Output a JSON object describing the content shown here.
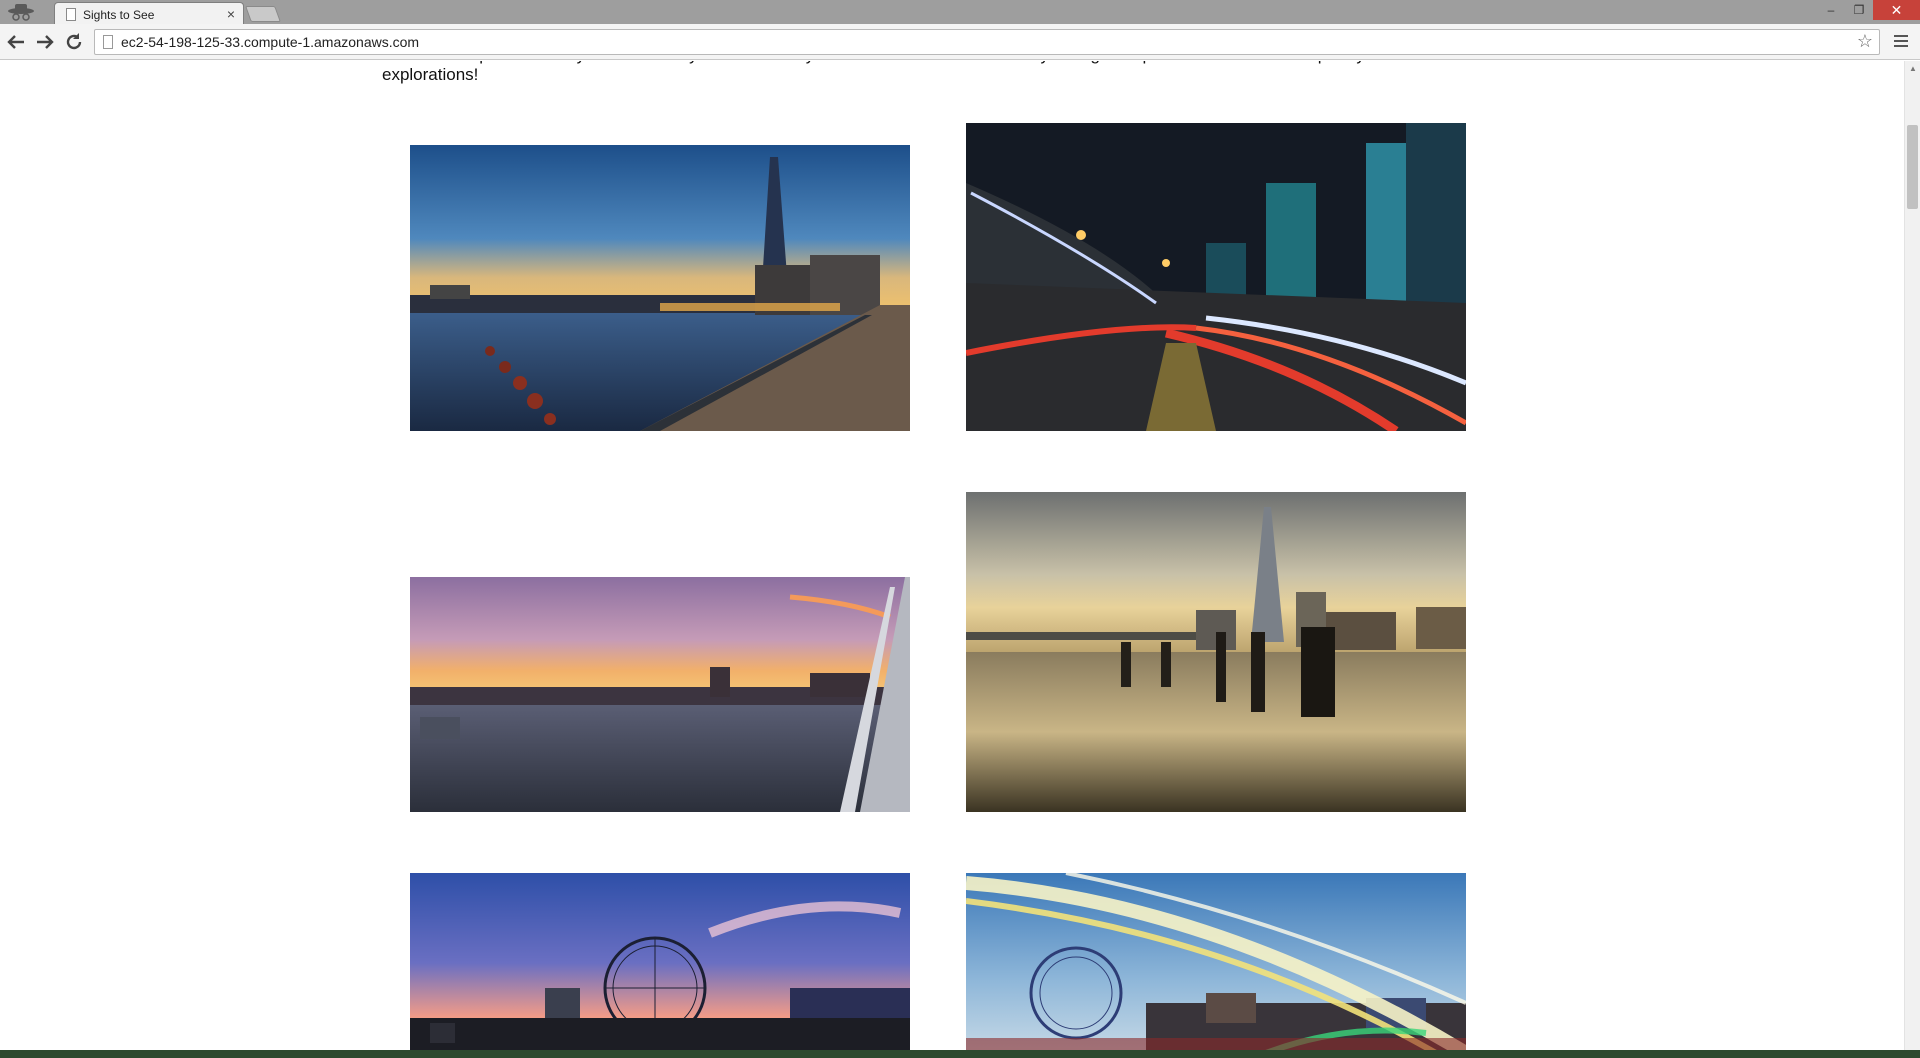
{
  "browser": {
    "tab_title": "Sights to See",
    "tab_close": "×",
    "address": "ec2-54-198-125-33.compute-1.amazonaws.com",
    "window_controls": {
      "minimize": "–",
      "maximize": "❐",
      "close": "✕"
    }
  },
  "page": {
    "intro_text": "Just click on pictures that you like. Once you've finished you can then click on the \"Always bring a Map!\" button to have a map for your explorations!"
  },
  "photos": [
    {
      "name": "shard-riverside-dusk-photo"
    },
    {
      "name": "city-light-trails-photo"
    },
    {
      "name": "thames-sunset-photo"
    },
    {
      "name": "shard-pier-reflection-photo"
    },
    {
      "name": "london-eye-sunset-photo"
    },
    {
      "name": "london-eye-light-streak-photo"
    }
  ],
  "icons": {
    "back": "back-arrow-icon",
    "forward": "forward-arrow-icon",
    "reload": "reload-icon",
    "star": "bookmark-star-icon",
    "menu": "menu-icon"
  },
  "colors": {
    "titlebar": "#9e9e9e",
    "close_button": "#c7423a",
    "toolbar": "#f4f4f4"
  }
}
